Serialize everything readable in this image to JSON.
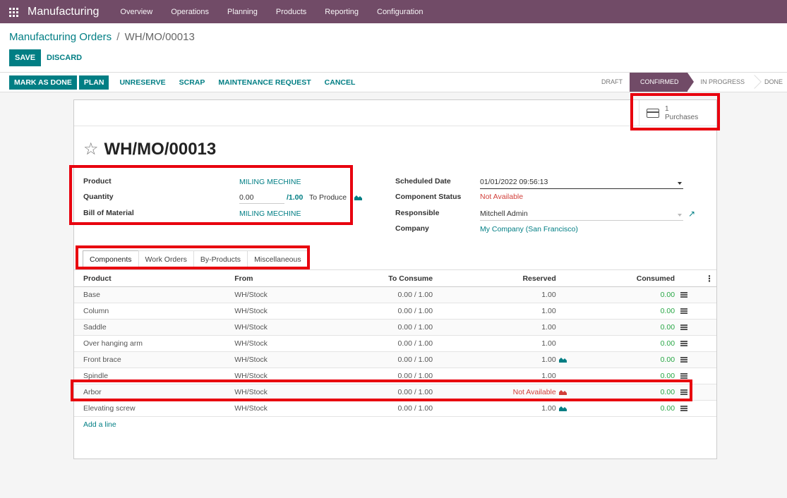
{
  "navbar": {
    "brand": "Manufacturing",
    "menu": [
      "Overview",
      "Operations",
      "Planning",
      "Products",
      "Reporting",
      "Configuration"
    ]
  },
  "breadcrumb": {
    "parent": "Manufacturing Orders",
    "separator": "/",
    "current": "WH/MO/00013"
  },
  "form_buttons": {
    "save": "SAVE",
    "discard": "DISCARD"
  },
  "actions": {
    "mark_as_done": "MARK AS DONE",
    "plan": "PLAN",
    "unreserve": "UNRESERVE",
    "scrap": "SCRAP",
    "maintenance_request": "MAINTENANCE REQUEST",
    "cancel": "CANCEL"
  },
  "stages": {
    "draft": "DRAFT",
    "confirmed": "CONFIRMED",
    "in_progress": "IN PROGRESS",
    "done": "DONE",
    "current": "CONFIRMED"
  },
  "smart_button": {
    "count": "1",
    "label": "Purchases",
    "icon": "credit-card-icon"
  },
  "record": {
    "title": "WH/MO/00013"
  },
  "fields": {
    "product_label": "Product",
    "product_value": "MILING MECHINE",
    "quantity_label": "Quantity",
    "quantity_value": "0.00",
    "quantity_total": "/1.00",
    "to_produce": "To Produce",
    "bom_label": "Bill of Material",
    "bom_value": "MILING MECHINE",
    "scheduled_date_label": "Scheduled Date",
    "scheduled_date_value": "01/01/2022 09:56:13",
    "component_status_label": "Component Status",
    "component_status_value": "Not Available",
    "responsible_label": "Responsible",
    "responsible_value": "Mitchell Admin",
    "company_label": "Company",
    "company_value": "My Company (San Francisco)"
  },
  "tabs": [
    "Components",
    "Work Orders",
    "By-Products",
    "Miscellaneous"
  ],
  "table": {
    "headers": {
      "product": "Product",
      "from": "From",
      "to_consume": "To Consume",
      "reserved": "Reserved",
      "consumed": "Consumed"
    },
    "rows": [
      {
        "product": "Base",
        "from": "WH/Stock",
        "to_consume": "0.00 / 1.00",
        "reserved": "1.00",
        "forecast_icon": false,
        "consumed": "0.00"
      },
      {
        "product": "Column",
        "from": "WH/Stock",
        "to_consume": "0.00 / 1.00",
        "reserved": "1.00",
        "forecast_icon": false,
        "consumed": "0.00"
      },
      {
        "product": "Saddle",
        "from": "WH/Stock",
        "to_consume": "0.00 / 1.00",
        "reserved": "1.00",
        "forecast_icon": false,
        "consumed": "0.00"
      },
      {
        "product": "Over hanging arm",
        "from": "WH/Stock",
        "to_consume": "0.00 / 1.00",
        "reserved": "1.00",
        "forecast_icon": false,
        "consumed": "0.00"
      },
      {
        "product": "Front brace",
        "from": "WH/Stock",
        "to_consume": "0.00 / 1.00",
        "reserved": "1.00",
        "forecast_icon": true,
        "consumed": "0.00"
      },
      {
        "product": "Spindle",
        "from": "WH/Stock",
        "to_consume": "0.00 / 1.00",
        "reserved": "1.00",
        "forecast_icon": false,
        "consumed": "0.00"
      },
      {
        "product": "Arbor",
        "from": "WH/Stock",
        "to_consume": "0.00 / 1.00",
        "reserved": "Not Available",
        "forecast_icon": true,
        "consumed": "0.00",
        "unavailable": true
      },
      {
        "product": "Elevating screw",
        "from": "WH/Stock",
        "to_consume": "0.00 / 1.00",
        "reserved": "1.00",
        "forecast_icon": true,
        "consumed": "0.00"
      }
    ],
    "add_line": "Add a line"
  },
  "colors": {
    "navbar": "#714b67",
    "primary": "#017e84",
    "danger": "#d23f3a",
    "success": "#28a745",
    "highlight": "#e8000e"
  }
}
